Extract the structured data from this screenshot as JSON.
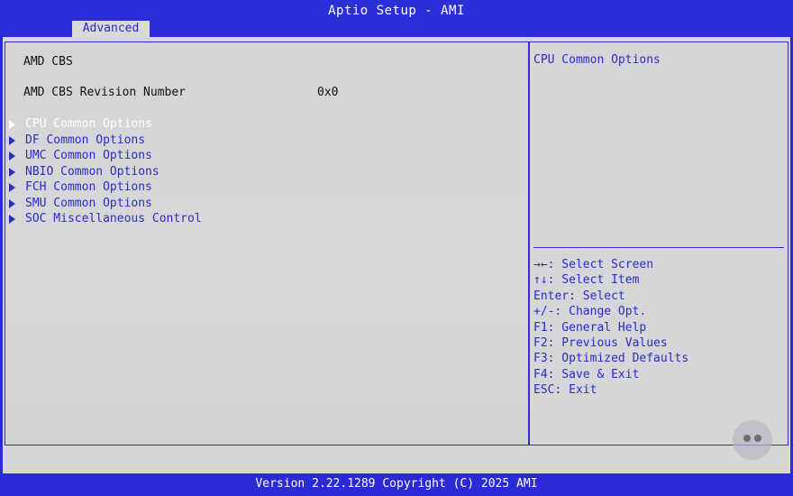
{
  "header": {
    "title": "Aptio Setup - AMI",
    "tab": "Advanced"
  },
  "main": {
    "heading": "AMD CBS",
    "revision_label": "AMD CBS Revision Number",
    "revision_value": "0x0",
    "menu_items": [
      "CPU Common Options",
      "DF Common Options",
      "UMC Common Options",
      "NBIO Common Options",
      "FCH Common Options",
      "SMU Common Options",
      "SOC Miscellaneous Control"
    ],
    "selected_index": 0
  },
  "help": {
    "description": "CPU Common Options",
    "keys": [
      "→←: Select Screen",
      "↑↓: Select Item",
      "Enter: Select",
      "+/-: Change Opt.",
      "F1: General Help",
      "F2: Previous Values",
      "F3: Optimized Defaults",
      "F4: Save & Exit",
      "ESC: Exit"
    ]
  },
  "footer": {
    "version": "Version 2.22.1289 Copyright (C) 2025 AMI"
  },
  "colors": {
    "frame_blue": "#2a2ad6",
    "panel_gray": "#d6d6d8",
    "text_blue": "#2b2bc8",
    "highlight": "#ffffff"
  }
}
